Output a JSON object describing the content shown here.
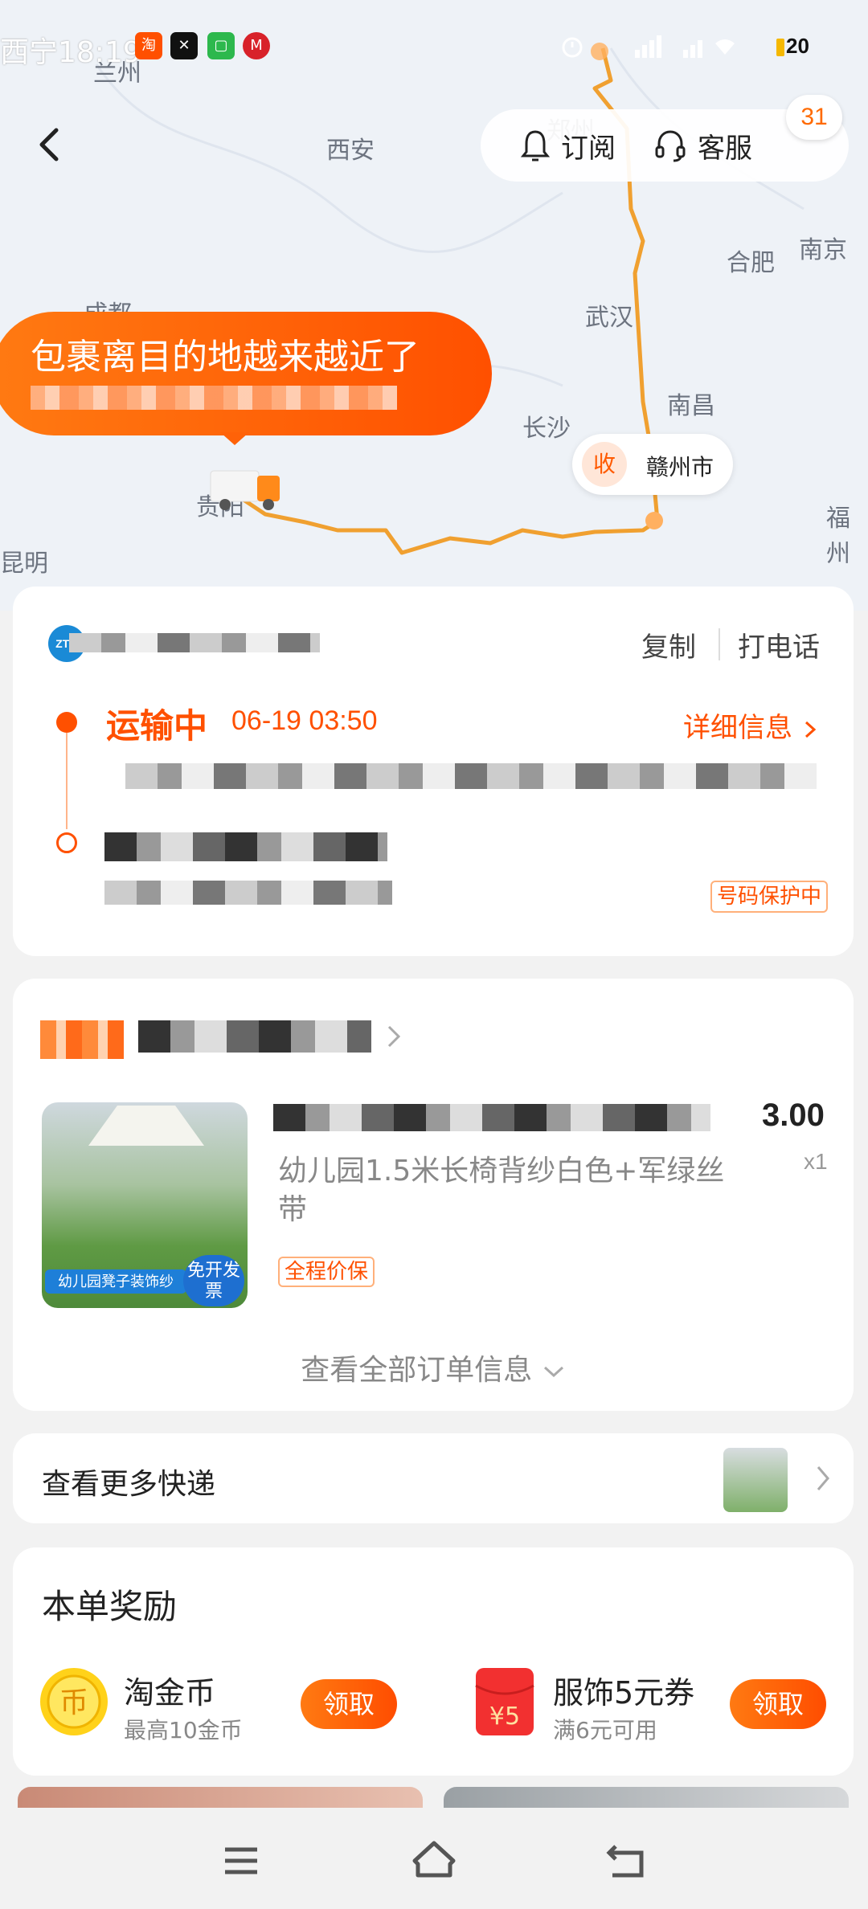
{
  "status_bar": {
    "time": "西宁18:19",
    "battery": "20"
  },
  "header": {
    "subscribe_label": "订阅",
    "service_label": "客服",
    "badge_count": "31"
  },
  "map": {
    "cities": [
      "兰州",
      "西安",
      "郑州",
      "合肥",
      "南京",
      "成都",
      "武汉",
      "南昌",
      "长沙",
      "贵阳",
      "福州",
      "昆明"
    ],
    "bubble_title": "包裹离目的地越来越近了",
    "receiver_label": "收",
    "receiver_city": "赣州市"
  },
  "logistics": {
    "copy_label": "复制",
    "call_label": "打电话",
    "status": "运输中",
    "status_time": "06-19 03:50",
    "detail_label": "详细信息",
    "protect_tag": "号码保护中",
    "accent_color": "#ff5000"
  },
  "order": {
    "product_title": "幼儿园1.5米长椅背纱白色+军绿丝带",
    "price": "3.00",
    "quantity": "x1",
    "price_tag": "全程价保",
    "view_all_label": "查看全部订单信息",
    "image_banner": "幼儿园凳子装饰纱",
    "image_badge": "免开发票"
  },
  "more_express": {
    "label": "查看更多快递"
  },
  "rewards": {
    "title": "本单奖励",
    "items": [
      {
        "name": "淘金币",
        "sub": "最高10金币",
        "button": "领取",
        "icon": "gold-coin-icon"
      },
      {
        "name": "服饰5元券",
        "sub": "满6元可用",
        "button": "领取",
        "icon": "red-packet-icon"
      }
    ]
  }
}
